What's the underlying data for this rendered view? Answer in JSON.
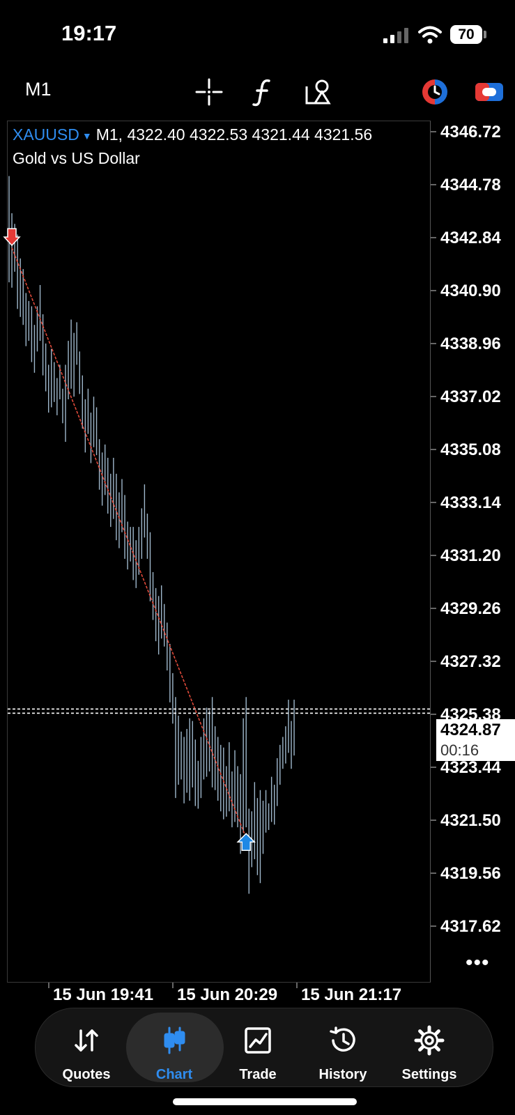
{
  "status": {
    "time": "19:17",
    "battery": "70"
  },
  "toolbar": {
    "timeframe": "M1"
  },
  "symbol": {
    "name": "XAUUSD",
    "timeframe": "M1,",
    "open": "4322.40",
    "high": "4322.53",
    "low": "4321.44",
    "close": "4321.56",
    "description": "Gold vs US Dollar"
  },
  "price_axis": {
    "ticks": [
      "4346.72",
      "4344.78",
      "4342.84",
      "4340.90",
      "4338.96",
      "4337.02",
      "4335.08",
      "4333.14",
      "4331.20",
      "4329.26",
      "4327.32",
      "4325.38",
      "4323.44",
      "4321.50",
      "4319.56",
      "4317.62"
    ]
  },
  "current_price": {
    "price": "4324.87",
    "countdown": "00:16"
  },
  "time_axis": {
    "labels": [
      "15 Jun 19:41",
      "15 Jun 20:29",
      "15 Jun 21:17"
    ]
  },
  "colors": {
    "accent": "#2f8df0",
    "bar": "#9fb8cc",
    "trendline": "#e04a3a",
    "sell_arrow": "#e53935",
    "buy_arrow": "#1e88e5"
  },
  "chart_data": {
    "type": "bar",
    "symbol": "XAUUSD",
    "timeframe": "M1",
    "ylim": [
      4316.5,
      4347.5
    ],
    "current_price": 4324.87,
    "bars": [
      {
        "h": 4345.0,
        "l": 4341.0
      },
      {
        "h": 4343.6,
        "l": 4340.8
      },
      {
        "h": 4343.2,
        "l": 4341.4
      },
      {
        "h": 4342.8,
        "l": 4340.0
      },
      {
        "h": 4341.9,
        "l": 4339.7
      },
      {
        "h": 4341.5,
        "l": 4339.4
      },
      {
        "h": 4340.6,
        "l": 4338.6
      },
      {
        "h": 4340.3,
        "l": 4338.8
      },
      {
        "h": 4340.1,
        "l": 4338.0
      },
      {
        "h": 4339.4,
        "l": 4337.6
      },
      {
        "h": 4340.1,
        "l": 4338.4
      },
      {
        "h": 4340.9,
        "l": 4338.8
      },
      {
        "h": 4339.8,
        "l": 4337.5
      },
      {
        "h": 4338.7,
        "l": 4336.9
      },
      {
        "h": 4337.9,
        "l": 4336.1
      },
      {
        "h": 4338.5,
        "l": 4336.3
      },
      {
        "h": 4338.0,
        "l": 4336.5
      },
      {
        "h": 4337.4,
        "l": 4336.0
      },
      {
        "h": 4337.9,
        "l": 4336.6
      },
      {
        "h": 4337.0,
        "l": 4335.7
      },
      {
        "h": 4337.9,
        "l": 4335.0
      },
      {
        "h": 4338.8,
        "l": 4336.6
      },
      {
        "h": 4339.6,
        "l": 4337.0
      },
      {
        "h": 4339.1,
        "l": 4336.7
      },
      {
        "h": 4339.5,
        "l": 4337.9
      },
      {
        "h": 4338.4,
        "l": 4336.8
      },
      {
        "h": 4337.5,
        "l": 4335.5
      },
      {
        "h": 4336.6,
        "l": 4334.6
      },
      {
        "h": 4337.0,
        "l": 4335.3
      },
      {
        "h": 4336.1,
        "l": 4334.2
      },
      {
        "h": 4336.7,
        "l": 4334.8
      },
      {
        "h": 4336.3,
        "l": 4334.5
      },
      {
        "h": 4335.1,
        "l": 4333.2
      },
      {
        "h": 4334.6,
        "l": 4332.6
      },
      {
        "h": 4334.9,
        "l": 4333.0
      },
      {
        "h": 4334.4,
        "l": 4332.3
      },
      {
        "h": 4333.8,
        "l": 4331.8
      },
      {
        "h": 4334.4,
        "l": 4332.1
      },
      {
        "h": 4333.8,
        "l": 4331.3
      },
      {
        "h": 4333.1,
        "l": 4331.0
      },
      {
        "h": 4333.6,
        "l": 4331.6
      },
      {
        "h": 4333.0,
        "l": 4330.6
      },
      {
        "h": 4332.0,
        "l": 4330.2
      },
      {
        "h": 4331.8,
        "l": 4330.5
      },
      {
        "h": 4331.8,
        "l": 4329.8
      },
      {
        "h": 4331.3,
        "l": 4329.5
      },
      {
        "h": 4331.8,
        "l": 4330.0
      },
      {
        "h": 4332.5,
        "l": 4330.6
      },
      {
        "h": 4333.4,
        "l": 4331.4
      },
      {
        "h": 4332.3,
        "l": 4330.6
      },
      {
        "h": 4331.6,
        "l": 4329.0
      },
      {
        "h": 4330.1,
        "l": 4328.3
      },
      {
        "h": 4329.5,
        "l": 4327.5
      },
      {
        "h": 4329.2,
        "l": 4327.0
      },
      {
        "h": 4329.6,
        "l": 4327.6
      },
      {
        "h": 4328.9,
        "l": 4327.3
      },
      {
        "h": 4328.2,
        "l": 4326.4
      },
      {
        "h": 4327.4,
        "l": 4325.2
      },
      {
        "h": 4326.3,
        "l": 4324.4
      },
      {
        "h": 4325.4,
        "l": 4321.6
      },
      {
        "h": 4324.7,
        "l": 4322.1
      },
      {
        "h": 4324.1,
        "l": 4322.3
      },
      {
        "h": 4323.9,
        "l": 4321.4
      },
      {
        "h": 4324.2,
        "l": 4321.8
      },
      {
        "h": 4324.6,
        "l": 4321.5
      },
      {
        "h": 4324.5,
        "l": 4322.0
      },
      {
        "h": 4323.8,
        "l": 4321.3
      },
      {
        "h": 4323.0,
        "l": 4321.2
      },
      {
        "h": 4323.9,
        "l": 4321.6
      },
      {
        "h": 4324.6,
        "l": 4322.3
      },
      {
        "h": 4325.0,
        "l": 4322.4
      },
      {
        "h": 4324.9,
        "l": 4322.6
      },
      {
        "h": 4325.4,
        "l": 4322.0
      },
      {
        "h": 4324.3,
        "l": 4321.9
      },
      {
        "h": 4323.9,
        "l": 4321.5
      },
      {
        "h": 4323.6,
        "l": 4321.1
      },
      {
        "h": 4323.5,
        "l": 4320.8
      },
      {
        "h": 4322.8,
        "l": 4320.9
      },
      {
        "h": 4323.7,
        "l": 4321.1
      },
      {
        "h": 4322.6,
        "l": 4320.5
      },
      {
        "h": 4323.4,
        "l": 4320.7
      },
      {
        "h": 4322.8,
        "l": 4320.5
      },
      {
        "h": 4322.5,
        "l": 4319.5
      },
      {
        "h": 4324.6,
        "l": 4320.3
      },
      {
        "h": 4325.4,
        "l": 4320.5
      },
      {
        "h": 4321.2,
        "l": 4318.0
      },
      {
        "h": 4321.1,
        "l": 4319.0
      },
      {
        "h": 4322.2,
        "l": 4319.3
      },
      {
        "h": 4321.6,
        "l": 4318.7
      },
      {
        "h": 4321.9,
        "l": 4318.4
      },
      {
        "h": 4321.5,
        "l": 4319.5
      },
      {
        "h": 4321.9,
        "l": 4320.3
      },
      {
        "h": 4321.4,
        "l": 4320.4
      },
      {
        "h": 4322.4,
        "l": 4320.7
      },
      {
        "h": 4322.1,
        "l": 4320.6
      },
      {
        "h": 4323.1,
        "l": 4321.3
      },
      {
        "h": 4323.6,
        "l": 4322.1
      },
      {
        "h": 4323.9,
        "l": 4322.7
      },
      {
        "h": 4324.3,
        "l": 4322.9
      },
      {
        "h": 4325.3,
        "l": 4323.3
      },
      {
        "h": 4324.5,
        "l": 4322.7
      },
      {
        "h": 4325.3,
        "l": 4323.2
      }
    ],
    "trendline": {
      "from": {
        "bar": 1,
        "price": 4342.3
      },
      "to": {
        "bar": 84,
        "price": 4320.1
      }
    },
    "markers": [
      {
        "type": "sell",
        "bar": 1,
        "price": 4342.6
      },
      {
        "type": "buy",
        "bar": 84,
        "price": 4320.0
      }
    ]
  },
  "nav": {
    "items": [
      {
        "label": "Quotes",
        "icon": "quotes-arrows-icon",
        "active": false
      },
      {
        "label": "Chart",
        "icon": "candlestick-chart-icon",
        "active": true
      },
      {
        "label": "Trade",
        "icon": "trade-chart-icon",
        "active": false
      },
      {
        "label": "History",
        "icon": "history-clock-icon",
        "active": false
      },
      {
        "label": "Settings",
        "icon": "gear-icon",
        "active": false
      }
    ]
  }
}
